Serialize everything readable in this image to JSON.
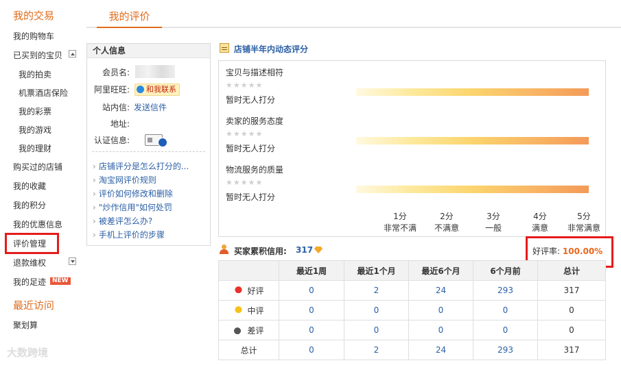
{
  "sidebar": {
    "section1_title": "我的交易",
    "items": [
      {
        "label": "我的购物车"
      },
      {
        "label": "已买到的宝贝"
      },
      {
        "label": "我的拍卖"
      },
      {
        "label": "机票酒店保险"
      },
      {
        "label": "我的彩票"
      },
      {
        "label": "我的游戏"
      },
      {
        "label": "我的理财"
      },
      {
        "label": "购买过的店铺"
      },
      {
        "label": "我的收藏"
      },
      {
        "label": "我的积分"
      },
      {
        "label": "我的优惠信息"
      },
      {
        "label": "评价管理"
      },
      {
        "label": "退款维权"
      },
      {
        "label": "我的足迹"
      }
    ],
    "new_badge": "NEW",
    "section2_title": "最近访问",
    "recent_item": "聚划算"
  },
  "tab": {
    "label": "我的评价"
  },
  "personal_info": {
    "title": "个人信息",
    "member_label": "会员名:",
    "wangwang_label": "阿里旺旺:",
    "wangwang_button": "和我联系",
    "message_label": "站内信:",
    "message_link": "发送信件",
    "address_label": "地址:",
    "cert_label": "认证信息:",
    "faq": [
      "店铺评分是怎么打分的...",
      "淘宝网评价规则",
      "评价如何修改和删除",
      "\"炒作信用\"如何处罚",
      "被差评怎么办?",
      "手机上评价的步骤"
    ]
  },
  "shop_rating": {
    "title": "店铺半年内动态评分",
    "items": [
      {
        "label": "宝贝与描述相符",
        "stars": "★★★★★",
        "status": "暂时无人打分"
      },
      {
        "label": "卖家的服务态度",
        "stars": "★★★★★",
        "status": "暂时无人打分"
      },
      {
        "label": "物流服务的质量",
        "stars": "★★★★★",
        "status": "暂时无人打分"
      }
    ],
    "scale": [
      {
        "score": "1分",
        "text": "非常不满"
      },
      {
        "score": "2分",
        "text": "不满意"
      },
      {
        "score": "3分",
        "text": "一般"
      },
      {
        "score": "4分",
        "text": "满意"
      },
      {
        "score": "5分",
        "text": "非常满意"
      }
    ]
  },
  "buyer_credit": {
    "label": "买家累积信用:",
    "score": "317",
    "good_rate_label": "好评率:",
    "good_rate_value": "100.00%",
    "columns": [
      "",
      "最近1周",
      "最近1个月",
      "最近6个月",
      "6个月前",
      "总计"
    ],
    "rows": [
      {
        "label": "好评",
        "values": [
          "0",
          "2",
          "24",
          "293",
          "317"
        ]
      },
      {
        "label": "中评",
        "values": [
          "0",
          "0",
          "0",
          "0",
          "0"
        ]
      },
      {
        "label": "差评",
        "values": [
          "0",
          "0",
          "0",
          "0",
          "0"
        ]
      },
      {
        "label": "总计",
        "values": [
          "0",
          "2",
          "24",
          "293",
          "317"
        ]
      }
    ]
  },
  "watermark": "大数跨境"
}
